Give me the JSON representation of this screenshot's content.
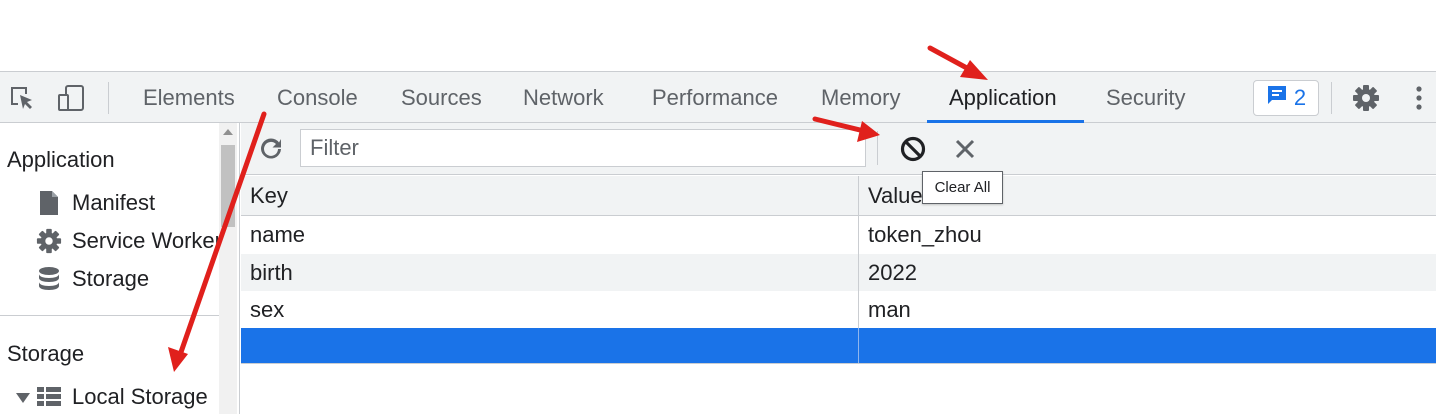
{
  "toolbar": {
    "tabs": [
      {
        "label": "Elements"
      },
      {
        "label": "Console"
      },
      {
        "label": "Sources"
      },
      {
        "label": "Network"
      },
      {
        "label": "Performance"
      },
      {
        "label": "Memory"
      },
      {
        "label": "Application"
      },
      {
        "label": "Security"
      }
    ],
    "active_tab": "Application",
    "issues_count": "2",
    "icons": [
      "inspect-element-icon",
      "device-toggle-icon",
      "issues-message-icon",
      "settings-gear-icon",
      "more-options-icon"
    ]
  },
  "sidebar": {
    "application_title": "Application",
    "application_items": [
      {
        "label": "Manifest",
        "icon": "document-icon"
      },
      {
        "label": "Service Workers",
        "icon": "gear-icon"
      },
      {
        "label": "Storage",
        "icon": "database-icon"
      }
    ],
    "storage_title": "Storage",
    "storage_items": [
      {
        "label": "Local Storage",
        "icon": "table-grid-icon",
        "expanded": true
      }
    ]
  },
  "filterbar": {
    "filter_placeholder": "Filter",
    "icons": [
      "refresh-icon",
      "clear-all-icon",
      "delete-selected-icon"
    ]
  },
  "tooltip": {
    "text": "Clear All"
  },
  "table": {
    "columns": [
      "Key",
      "Value"
    ],
    "rows": [
      {
        "key": "name",
        "value": "token_zhou"
      },
      {
        "key": "birth",
        "value": "2022"
      },
      {
        "key": "sex",
        "value": "man"
      },
      {
        "key": "",
        "value": ""
      }
    ],
    "selected_row_index": 3
  },
  "colors": {
    "accent": "#1a73e8",
    "toolbar_bg": "#f1f3f4",
    "annotation_arrow": "#e0201c"
  }
}
